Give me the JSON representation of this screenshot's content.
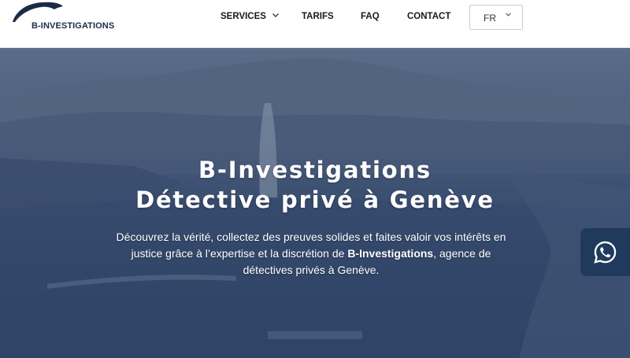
{
  "brand": {
    "name": "B-INVESTIGATIONS"
  },
  "nav": {
    "items": [
      {
        "label": "SERVICES",
        "has_dropdown": true
      },
      {
        "label": "TARIFS"
      },
      {
        "label": "FAQ"
      },
      {
        "label": "CONTACT"
      }
    ]
  },
  "language": {
    "selected": "FR"
  },
  "hero": {
    "title_line1": "B-Investigations",
    "title_line2": "Détective privé à Genève",
    "desc_part1": "Découvrez la vérité, collectez des preuves solides et faites valoir vos intérêts en justice grâce à l’expertise et la discrétion de ",
    "desc_bold": "B-Investigations",
    "desc_part2": ", agence de détectives privés à Genève."
  },
  "floating": {
    "whatsapp_icon": "whatsapp-icon"
  },
  "colors": {
    "brand_navy": "#1c2b45",
    "whatsapp_bg": "#1f3a5c",
    "overlay": "#34496c"
  }
}
